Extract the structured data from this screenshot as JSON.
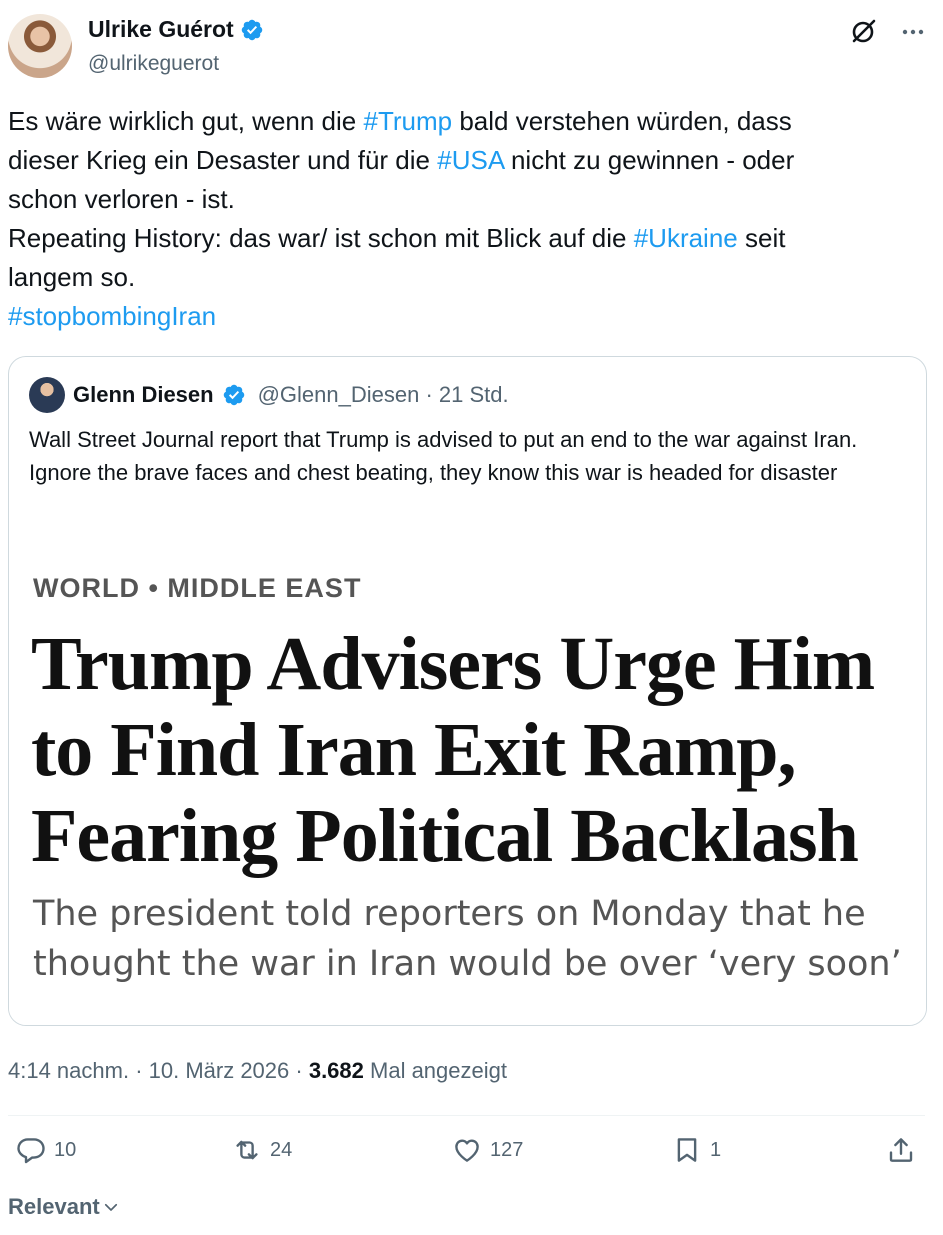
{
  "author": {
    "name": "Ulrike Guérot",
    "handle": "@ulrikeguerot",
    "verified_icon": "verified-badge-icon"
  },
  "top_icons": [
    "grok-icon",
    "more-icon"
  ],
  "tweet": {
    "segments": [
      {
        "text": "Es wäre wirklich gut, wenn die ",
        "hashtag": false
      },
      {
        "text": "#Trump",
        "hashtag": true
      },
      {
        "text": " bald verstehen würden, dass\ndieser Krieg ein Desaster und für die ",
        "hashtag": false
      },
      {
        "text": "#USA",
        "hashtag": true
      },
      {
        "text": " nicht zu gewinnen - oder\nschon verloren - ist.\nRepeating History: das war/ ist schon mit Blick auf die ",
        "hashtag": false
      },
      {
        "text": "#Ukraine",
        "hashtag": true
      },
      {
        "text": " seit\nlangem so.\n",
        "hashtag": false
      },
      {
        "text": "#stopbombingIran",
        "hashtag": true
      }
    ]
  },
  "quote": {
    "name": "Glenn Diesen",
    "handle": "@Glenn_Diesen · 21 Std.",
    "text": "Wall Street Journal report that Trump is advised to put an end to the war against Iran. Ignore the brave faces and chest beating, they know this war is headed for disaster",
    "image": {
      "kicker": "WORLD • MIDDLE EAST",
      "headline": "Trump Advisers Urge Him to Find Iran Exit Ramp, Fearing Political Backlash",
      "subhead": "The president told reporters on Monday that he thought the war in Iran would be over ‘very soon’"
    }
  },
  "meta": {
    "time": "4:14 nachm. · 10. März 2026 · ",
    "views": "3.682",
    "views_label": " Mal angezeigt"
  },
  "actions": {
    "replies": "10",
    "retweets": "24",
    "likes": "127",
    "bookmarks": "1"
  },
  "sort": {
    "label": "Relevant"
  },
  "colors": {
    "accent": "#1d9bf0",
    "text": "#0f1419",
    "secondary": "#536471",
    "border": "#cfd9de"
  }
}
